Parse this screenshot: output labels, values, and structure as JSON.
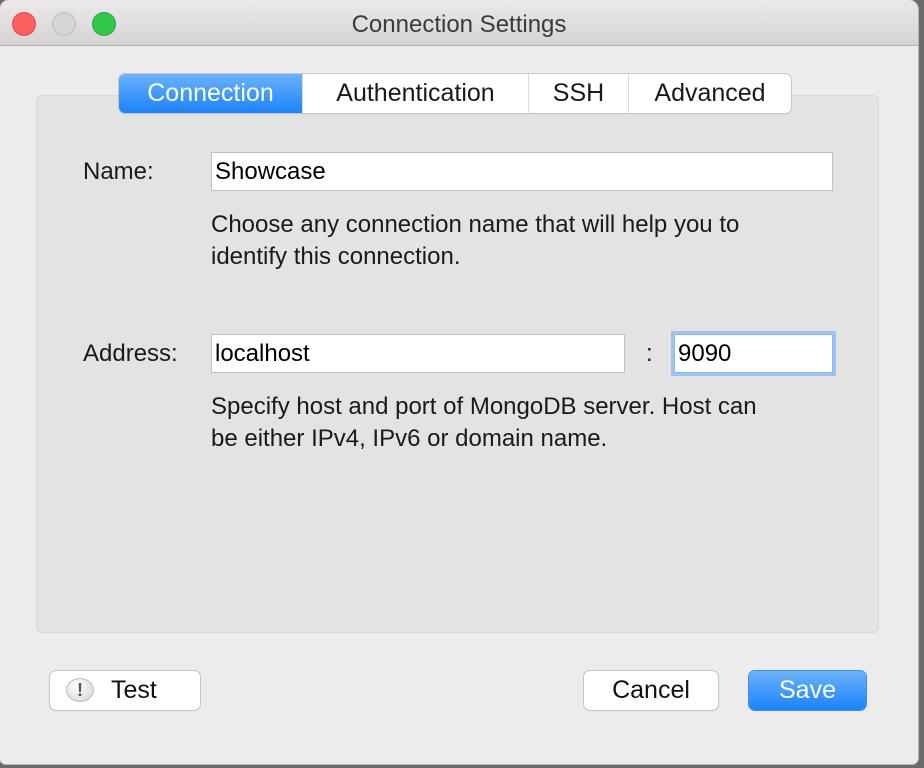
{
  "window": {
    "title": "Connection Settings",
    "controls": [
      "close",
      "minimize",
      "maximize"
    ]
  },
  "tabs": [
    {
      "label": "Connection",
      "active": true
    },
    {
      "label": "Authentication",
      "active": false
    },
    {
      "label": "SSH",
      "active": false
    },
    {
      "label": "Advanced",
      "active": false
    }
  ],
  "form": {
    "name": {
      "label": "Name:",
      "value": "Showcase",
      "hint_line1": "Choose any connection name that will help you to",
      "hint_line2": "identify this connection."
    },
    "address": {
      "label": "Address:",
      "host_value": "localhost",
      "separator": ":",
      "port_value": "9090",
      "hint_line1": "Specify host and port of MongoDB server. Host can",
      "hint_line2": "be either IPv4, IPv6 or domain name."
    }
  },
  "buttons": {
    "test_label": "Test",
    "test_icon": "!",
    "cancel_label": "Cancel",
    "save_label": "Save"
  },
  "colors": {
    "accent": "#1a82fb",
    "close": "#fc605c",
    "maximize": "#34c84a"
  }
}
